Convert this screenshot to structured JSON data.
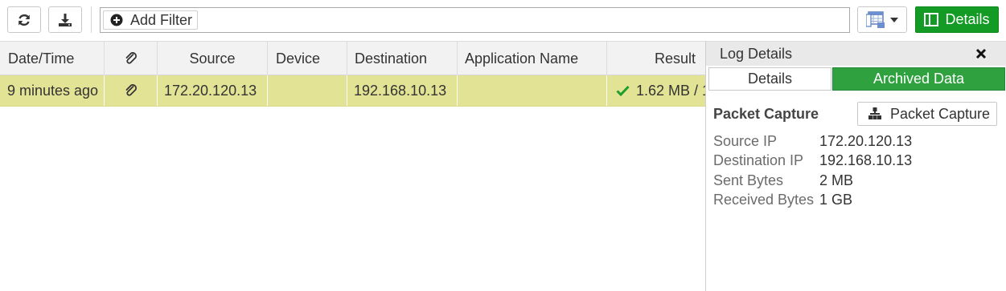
{
  "toolbar": {
    "refresh_icon": "refresh-icon",
    "download_icon": "download-icon",
    "add_filter_label": "Add Filter",
    "view_options_icon": "table-view-icon",
    "details_label": "Details",
    "accent_color": "#139b25"
  },
  "table": {
    "columns": [
      "Date/Time",
      "",
      "Source",
      "Device",
      "Destination",
      "Application Name",
      "Result"
    ],
    "rows": [
      {
        "datetime": "9 minutes ago",
        "attachment_icon": "paperclip-icon",
        "source": "172.20.120.13",
        "device": "",
        "destination": "192.168.10.13",
        "application": "",
        "result": "1.62 MB / 1",
        "result_icon": "checkmark-icon",
        "row_color": "#e3e396"
      }
    ]
  },
  "log_details": {
    "title": "Log Details",
    "tabs": [
      "Details",
      "Archived Data"
    ],
    "active_tab": "Archived Data",
    "packet_capture_label": "Packet Capture",
    "packet_capture_button": "Packet Capture",
    "fields": [
      {
        "label": "Source IP",
        "value": "172.20.120.13"
      },
      {
        "label": "Destination IP",
        "value": "192.168.10.13"
      },
      {
        "label": "Sent Bytes",
        "value": "2 MB"
      },
      {
        "label": "Received Bytes",
        "value": "1 GB"
      }
    ]
  }
}
